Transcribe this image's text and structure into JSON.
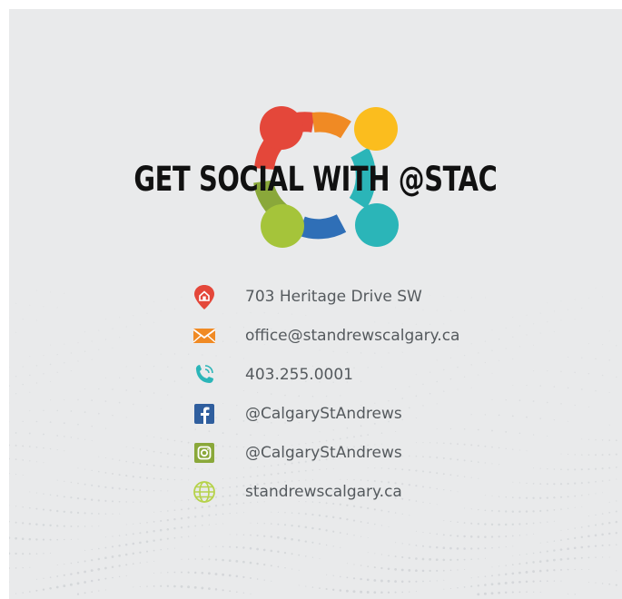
{
  "headline": "GET SOCIAL WITH @STAC",
  "logo_colors": {
    "red": "#e4473a",
    "orange": "#f08a24",
    "yellow": "#fbbd1e",
    "teal": "#2bb5b8",
    "blue": "#2f6fb7",
    "green": "#a5c43a",
    "olive": "#8aa83a"
  },
  "contacts": [
    {
      "icon": "location-pin-icon",
      "color": "#e4473a",
      "text": "703 Heritage Drive SW"
    },
    {
      "icon": "envelope-icon",
      "color": "#f08a24",
      "text": "office@standrewscalgary.ca"
    },
    {
      "icon": "phone-icon",
      "color": "#2bb5b8",
      "text": "403.255.0001"
    },
    {
      "icon": "facebook-icon",
      "color": "#2f5e9e",
      "text": "@CalgaryStAndrews"
    },
    {
      "icon": "instagram-icon",
      "color": "#8aa83a",
      "text": "@CalgaryStAndrews"
    },
    {
      "icon": "globe-icon",
      "color": "#b6d24a",
      "text": "standrewscalgary.ca"
    }
  ]
}
